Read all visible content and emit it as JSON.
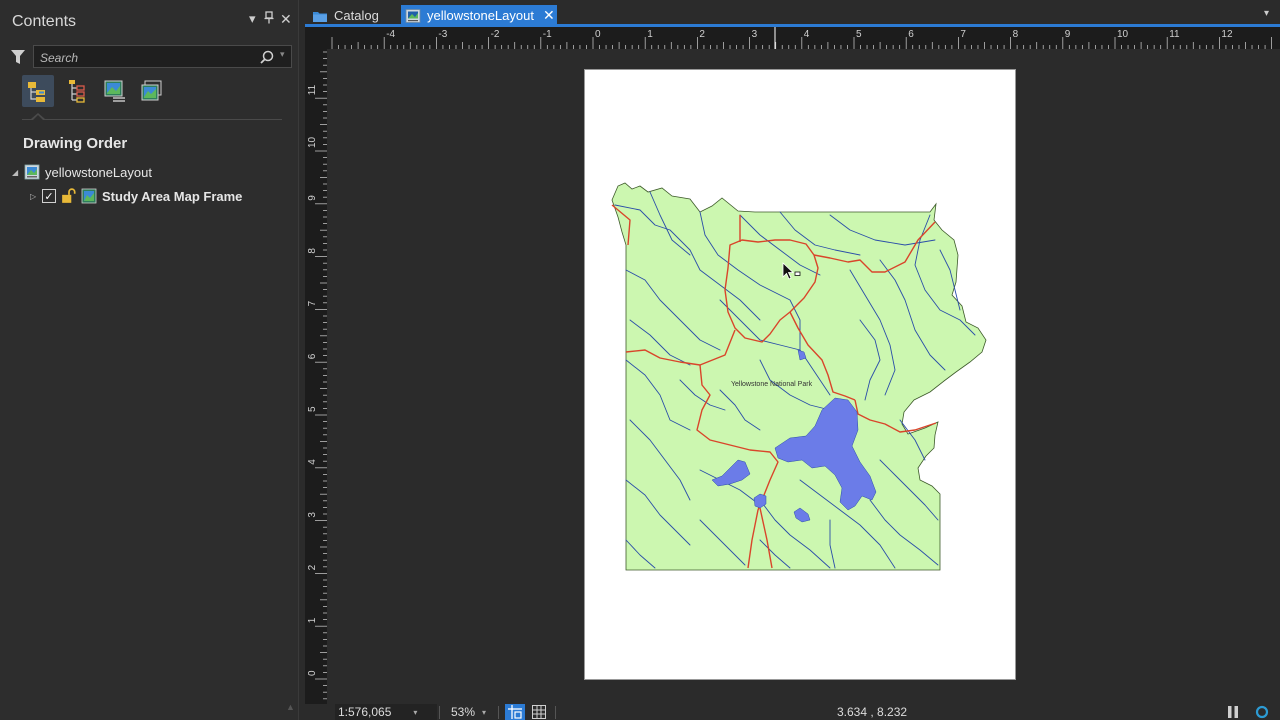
{
  "contents": {
    "title": "Contents",
    "menu_glyph": "▾",
    "pin_glyph": "⊥",
    "close_glyph": "✕",
    "search_placeholder": "Search",
    "view_buttons": [
      "list-by-drawing-order-icon",
      "list-by-selection-icon",
      "list-by-editing-icon",
      "list-by-snapping-icon"
    ],
    "heading": "Drawing Order",
    "tree": {
      "layout_name": "yellowstoneLayout",
      "layout_expanded_glyph": "◢",
      "mapframe_name": "Study Area Map Frame",
      "mapframe_collapsed_glyph": "▷",
      "mapframe_checked": "✓"
    }
  },
  "tabs": {
    "items": [
      {
        "label": "Catalog",
        "icon": "catalog-icon",
        "active": false
      },
      {
        "label": "yellowstoneLayout",
        "icon": "layout-icon",
        "active": true
      }
    ],
    "close_glyph": "✕",
    "overflow_glyph": "▾"
  },
  "rulers": {
    "horizontal_labels": [
      "-4",
      "-3",
      "-2",
      "-1",
      "0",
      "1",
      "2",
      "3",
      "4",
      "5",
      "6",
      "7",
      "8",
      "9",
      "10",
      "11",
      "12"
    ],
    "vertical_labels": [
      "11",
      "10",
      "9",
      "8",
      "7",
      "6",
      "5",
      "4",
      "3",
      "2",
      "1",
      "0"
    ]
  },
  "map": {
    "park_label": "Yellowstone National Park",
    "colors": {
      "land": "#ccf7b0",
      "rivers": "#2a4da8",
      "roads": "#d9452a",
      "lakes": "#6b7ce8",
      "page": "#ffffff"
    }
  },
  "status": {
    "scale": "1:576,065",
    "zoom": "53%",
    "caret": "▾",
    "coordinates": "3.634 , 8.232"
  }
}
